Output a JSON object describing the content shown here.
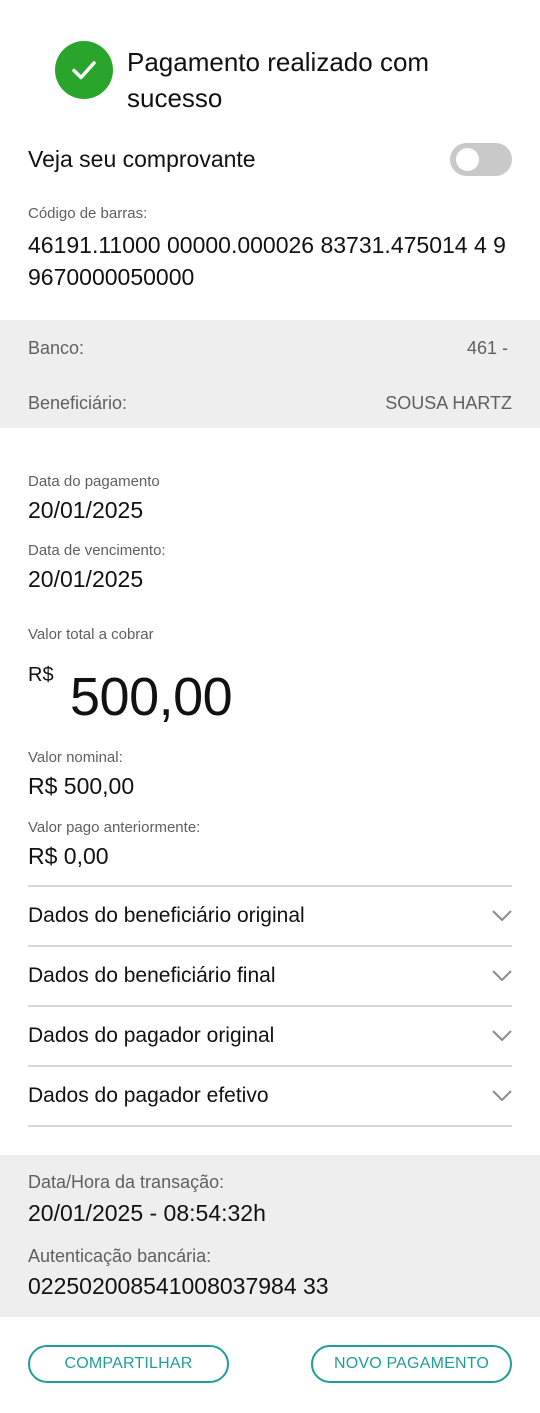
{
  "header": {
    "success_title": "Pagamento realizado com sucesso",
    "success_icon": "check-circle-icon",
    "success_color": "#2aa52c"
  },
  "receipt_toggle": {
    "label": "Veja seu comprovante",
    "on": false
  },
  "barcode": {
    "label": "Código de barras:",
    "value": "46191.11000 00000.000026 83731.475014 4 99670000050000"
  },
  "bank_info": {
    "bank_label": "Banco:",
    "bank_value": "461 -",
    "beneficiary_label": "Beneficiário:",
    "beneficiary_value": "SOUSA HARTZ"
  },
  "dates": {
    "payment_label": "Data do pagamento",
    "payment_value": "20/01/2025",
    "due_label": "Data de vencimento:",
    "due_value": "20/01/2025"
  },
  "total": {
    "label": "Valor total a cobrar",
    "currency": "R$",
    "amount": "500,00"
  },
  "amounts": {
    "nominal_label": "Valor nominal:",
    "nominal_value": "R$ 500,00",
    "previous_label": "Valor pago anteriormente:",
    "previous_value": "R$ 0,00"
  },
  "accordions": [
    {
      "label": "Dados do beneficiário original"
    },
    {
      "label": "Dados do beneficiário final"
    },
    {
      "label": "Dados do pagador original"
    },
    {
      "label": "Dados do pagador efetivo"
    }
  ],
  "transaction": {
    "datetime_label": "Data/Hora da transação:",
    "datetime_value": "20/01/2025 - 08:54:32h",
    "auth_label": "Autenticação bancária:",
    "auth_value": "022502008541008037984 33"
  },
  "actions": {
    "share_label": "COMPARTILHAR",
    "new_payment_label": "NOVO PAGAMENTO",
    "accent_color": "#1f9e98"
  }
}
